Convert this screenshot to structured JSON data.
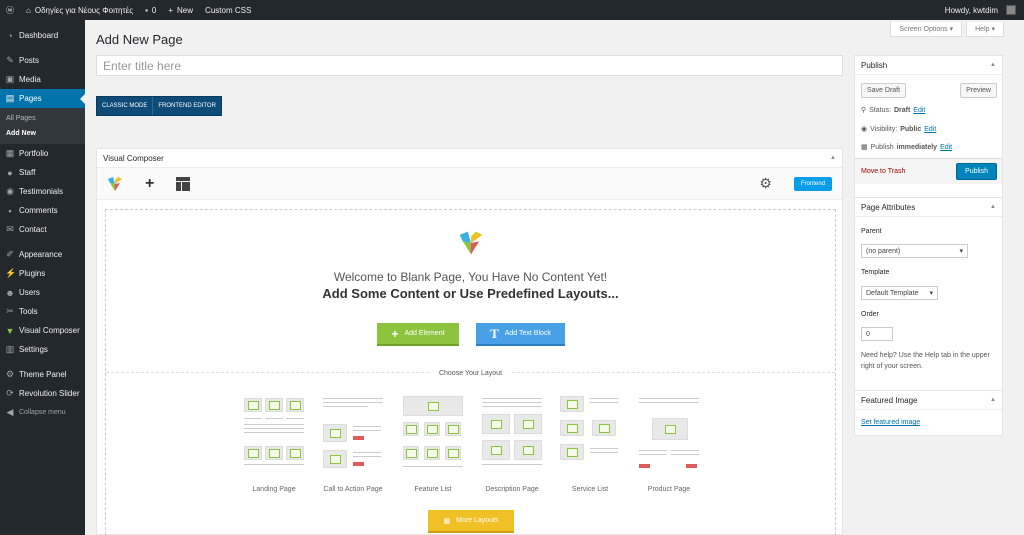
{
  "adminbar": {
    "site": "Οδηγίες για Νέους Φοιτητές",
    "comments": "0",
    "new": "New",
    "custom_css": "Custom CSS",
    "howdy": "Howdy, kwtdim"
  },
  "sidebar": {
    "items": [
      {
        "label": "Dashboard",
        "icon": "dashboard-icon"
      },
      {
        "label": "Posts",
        "icon": "pin-icon"
      },
      {
        "label": "Media",
        "icon": "media-icon"
      },
      {
        "label": "Pages",
        "icon": "pages-icon"
      },
      {
        "label": "Portfolio",
        "icon": "portfolio-icon"
      },
      {
        "label": "Staff",
        "icon": "staff-icon"
      },
      {
        "label": "Testimonials",
        "icon": "testimonials-icon"
      },
      {
        "label": "Comments",
        "icon": "comments-icon"
      },
      {
        "label": "Contact",
        "icon": "contact-icon"
      },
      {
        "label": "Appearance",
        "icon": "appearance-icon"
      },
      {
        "label": "Plugins",
        "icon": "plugins-icon"
      },
      {
        "label": "Users",
        "icon": "users-icon"
      },
      {
        "label": "Tools",
        "icon": "tools-icon"
      },
      {
        "label": "Visual Composer",
        "icon": "visual-composer-icon"
      },
      {
        "label": "Settings",
        "icon": "settings-icon"
      },
      {
        "label": "Theme Panel",
        "icon": "theme-panel-icon"
      },
      {
        "label": "Revolution Slider",
        "icon": "revolution-slider-icon"
      },
      {
        "label": "Collapse menu",
        "icon": "collapse-icon"
      }
    ],
    "submenu": [
      "All Pages",
      "Add New"
    ]
  },
  "top": {
    "screen_options": "Screen Options",
    "help": "Help"
  },
  "page": {
    "title": "Add New Page",
    "title_placeholder": "Enter title here",
    "classic_mode": "CLASSIC MODE",
    "frontend_editor": "FRONTEND EDITOR"
  },
  "vc": {
    "title": "Visual Composer",
    "frontend": "Frontend",
    "welcome": "Welcome to Blank Page, You Have No Content Yet!",
    "sub": "Add Some Content or Use Predefined Layouts...",
    "add_element": "Add Element",
    "add_text_block": "Add Text Block",
    "choose_layout": "Choose Your Layout",
    "layouts": [
      "Landing Page",
      "Call to Action Page",
      "Feature List",
      "Description Page",
      "Service List",
      "Product Page"
    ],
    "more_layouts": "More Layouts"
  },
  "publish": {
    "title": "Publish",
    "save_draft": "Save Draft",
    "preview": "Preview",
    "status_label": "Status:",
    "status_value": "Draft",
    "visibility_label": "Visibility:",
    "visibility_value": "Public",
    "publish_label": "Publish",
    "publish_value": "immediately",
    "edit": "Edit",
    "trash": "Move to Trash",
    "publish_btn": "Publish"
  },
  "attributes": {
    "title": "Page Attributes",
    "parent_label": "Parent",
    "parent_value": "(no parent)",
    "template_label": "Template",
    "template_value": "Default Template",
    "order_label": "Order",
    "order_value": "0",
    "help": "Need help? Use the Help tab in the upper right of your screen."
  },
  "featured": {
    "title": "Featured Image",
    "link": "Set featured image"
  }
}
